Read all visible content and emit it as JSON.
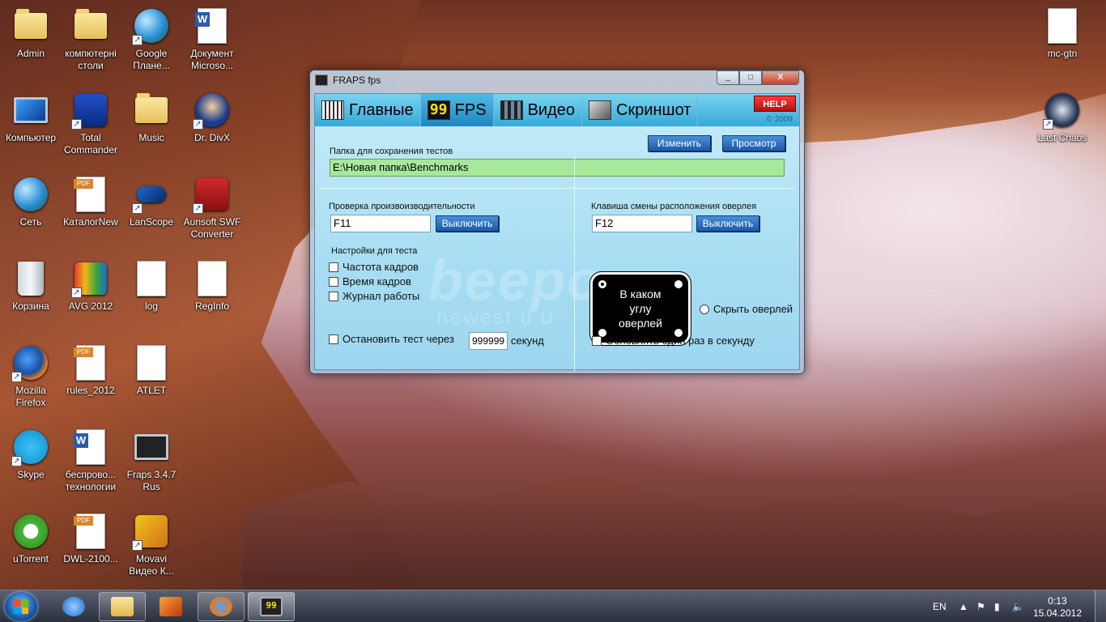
{
  "desktop_icons": {
    "admin": "Admin",
    "computer_tables": "компютерні столи",
    "google_earth": "Google Плане...",
    "word_doc": "Документ Microso...",
    "computer": "Компьютер",
    "total_commander": "Total Commander",
    "music": "Music",
    "divx": "Dr. DivX",
    "network": "Сеть",
    "catalog": "КаталогNew",
    "lanscope": "LanScope",
    "aunsoft": "Aunsoft SWF Converter",
    "trash": "Корзина",
    "avg": "AVG 2012",
    "log": "log",
    "reginfo": "RegInfo",
    "firefox": "Mozilla Firefox",
    "rules": "rules_2012",
    "atlet": "ATLET",
    "skype": "Skype",
    "wireless": "беспрово... технологии",
    "fraps": "Fraps 3.4.7 Rus",
    "utorrent": "uTorrent",
    "dwl": "DWL-2100...",
    "movavi": "Movavi Видео К...",
    "mcgtn": "mc-gtn",
    "lastchaos": "Last Chaos"
  },
  "window": {
    "title": "FRAPS fps",
    "minimize": "_",
    "maximize": "□",
    "close": "X",
    "tabs": {
      "main": "Главные",
      "fps_icon": "99",
      "fps": "FPS",
      "video": "Видео",
      "screenshot": "Скриншот"
    },
    "help": "HELP",
    "copyright": "© 2009",
    "folder_label": "Папка для сохранения тестов",
    "change_btn": "Изменить",
    "browse_btn": "Просмотр",
    "folder_path": "E:\\Новая папка\\Benchmarks",
    "perf_label": "Проверка произвоизводительности",
    "perf_key": "F11",
    "perf_disable": "Выключить",
    "overlay_label": "Клавиша смены расположения оверлея",
    "overlay_key": "F12",
    "overlay_disable": "Выключить",
    "settings_label": "Настройки для теста",
    "cb_framerate": "Частота кадров",
    "cb_frametime": "Время кадров",
    "cb_log": "Журнал работы",
    "stop_test": "Остановить тест через",
    "stop_seconds": "999999",
    "seconds_label": "секунд",
    "overlay_corner": "В каком углу оверлей",
    "hide_overlay": "Скрыть оверлей",
    "update_once": "Обновлять один раз в секунду",
    "watermark": "beepo",
    "watermark2": "newest u u"
  },
  "taskbar": {
    "fraps_icon": "99",
    "lang": "EN",
    "time": "0:13",
    "date": "15.04.2012"
  }
}
